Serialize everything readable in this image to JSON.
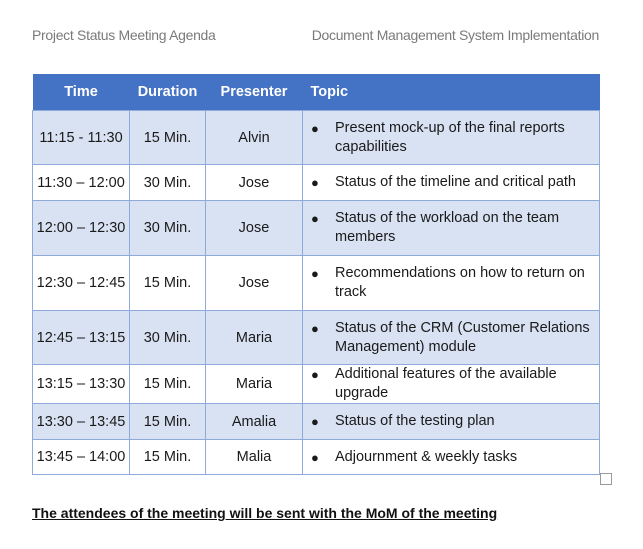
{
  "header": {
    "left": "Project Status Meeting Agenda",
    "right": "Document Management System Implementation"
  },
  "table": {
    "columns": [
      "Time",
      "Duration",
      "Presenter",
      "Topic"
    ],
    "rows": [
      {
        "time": "11:15 - 11:30",
        "duration": "15 Min.",
        "presenter": "Alvin",
        "topic": "Present mock-up of the final reports capabilities"
      },
      {
        "time": "11:30 – 12:00",
        "duration": "30 Min.",
        "presenter": "Jose",
        "topic": "Status of the timeline and critical path"
      },
      {
        "time": "12:00 – 12:30",
        "duration": "30 Min.",
        "presenter": "Jose",
        "topic": "Status of the workload on the team members"
      },
      {
        "time": "12:30 – 12:45",
        "duration": "15 Min.",
        "presenter": "Jose",
        "topic": "Recommendations on how to return on track"
      },
      {
        "time": "12:45 – 13:15",
        "duration": "30 Min.",
        "presenter": "Maria",
        "topic": "Status of the CRM (Customer Relations Management) module"
      },
      {
        "time": "13:15 – 13:30",
        "duration": "15 Min.",
        "presenter": "Maria",
        "topic": "Additional features of the available upgrade"
      },
      {
        "time": "13:30 – 13:45",
        "duration": "15 Min.",
        "presenter": "Amalia",
        "topic": "Status of the testing plan"
      },
      {
        "time": "13:45 – 14:00",
        "duration": "15 Min.",
        "presenter": "Malia",
        "topic": "Adjournment & weekly tasks"
      }
    ],
    "bullet": "●"
  },
  "footer": "The attendees of the meeting will be sent with the MoM of the meeting",
  "colors": {
    "header_bg": "#4472c4",
    "shaded_row": "#d9e2f3",
    "border": "#8eaadb"
  }
}
